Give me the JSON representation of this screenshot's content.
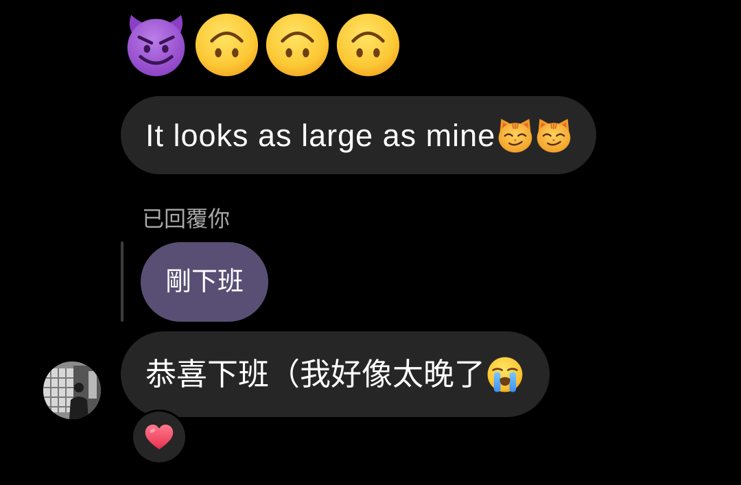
{
  "colors": {
    "background": "#000000",
    "bubble": "#262626",
    "quoted_bubble": "#594f74",
    "reply_label": "#a8a8a8",
    "reply_line": "#3d3d3d",
    "text": "#ffffff",
    "heart": "#e8304f"
  },
  "thread": {
    "emoji_message": {
      "icons": [
        "smiling-face-with-horns-icon",
        "upside-down-face-icon",
        "upside-down-face-icon",
        "upside-down-face-icon"
      ]
    },
    "messages": [
      {
        "text": "It looks as large as mine",
        "trailing_icons": [
          "grinning-cat-icon",
          "grinning-cat-icon"
        ]
      },
      {
        "text": "恭喜下班（我好像太晚了",
        "trailing_icons": [
          "loudly-crying-face-icon"
        ],
        "reaction_icon": "red-heart-icon",
        "sender_avatar": "profile-photo"
      }
    ],
    "reply": {
      "label": "已回覆你",
      "quoted_text": "剛下班"
    }
  }
}
